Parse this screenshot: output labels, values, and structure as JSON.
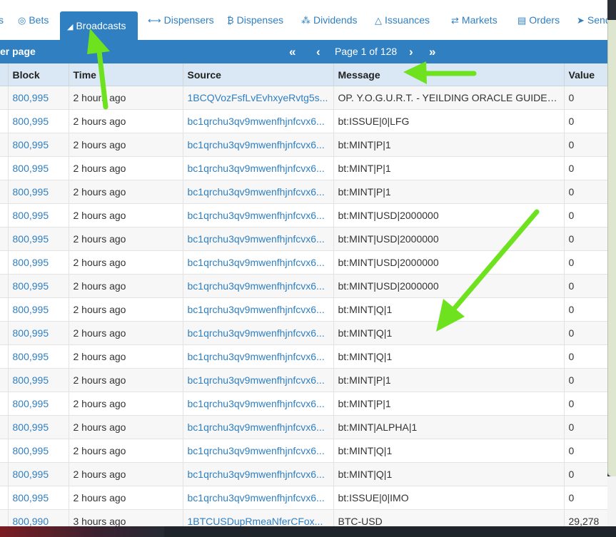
{
  "tabs": [
    {
      "label": "Bets",
      "icon": "target-icon",
      "glyph": "◎"
    },
    {
      "label": "Broadcasts",
      "icon": "megaphone-icon",
      "glyph": "📢",
      "active": true
    },
    {
      "label": "Dispensers",
      "icon": "arrows-horizontal-icon",
      "glyph": "⟷"
    },
    {
      "label": "Dispenses",
      "icon": "bitcoin-icon",
      "glyph": "₿"
    },
    {
      "label": "Dividends",
      "icon": "sitemap-icon",
      "glyph": "⁂"
    },
    {
      "label": "Issuances",
      "icon": "bank-icon",
      "glyph": "🏛"
    },
    {
      "label": "Markets",
      "icon": "exchange-icon",
      "glyph": "⇄"
    },
    {
      "label": "Orders",
      "icon": "book-icon",
      "glyph": "📘"
    },
    {
      "label": "Send",
      "icon": "paper-plane-icon",
      "glyph": "➤"
    }
  ],
  "pager": {
    "per_page_label": "er page",
    "first": "«",
    "prev": "‹",
    "page_text": "Page 1 of 128",
    "next": "›",
    "last": "»"
  },
  "table": {
    "headers": [
      "Block",
      "Time",
      "Source",
      "Message",
      "Value"
    ],
    "rows": [
      [
        "800,995",
        "2 hours ago",
        "1BCQVozFsfLvEvhxyeRvtg5s...",
        "OP. Y.O.G.U.R.T. - YEILDING ORACLE GUIDES...",
        "0"
      ],
      [
        "800,995",
        "2 hours ago",
        "bc1qrchu3qv9mwenfhjnfcvx6...",
        "bt:ISSUE|0|LFG",
        "0"
      ],
      [
        "800,995",
        "2 hours ago",
        "bc1qrchu3qv9mwenfhjnfcvx6...",
        "bt:MINT|P|1",
        "0"
      ],
      [
        "800,995",
        "2 hours ago",
        "bc1qrchu3qv9mwenfhjnfcvx6...",
        "bt:MINT|P|1",
        "0"
      ],
      [
        "800,995",
        "2 hours ago",
        "bc1qrchu3qv9mwenfhjnfcvx6...",
        "bt:MINT|P|1",
        "0"
      ],
      [
        "800,995",
        "2 hours ago",
        "bc1qrchu3qv9mwenfhjnfcvx6...",
        "bt:MINT|USD|2000000",
        "0"
      ],
      [
        "800,995",
        "2 hours ago",
        "bc1qrchu3qv9mwenfhjnfcvx6...",
        "bt:MINT|USD|2000000",
        "0"
      ],
      [
        "800,995",
        "2 hours ago",
        "bc1qrchu3qv9mwenfhjnfcvx6...",
        "bt:MINT|USD|2000000",
        "0"
      ],
      [
        "800,995",
        "2 hours ago",
        "bc1qrchu3qv9mwenfhjnfcvx6...",
        "bt:MINT|USD|2000000",
        "0"
      ],
      [
        "800,995",
        "2 hours ago",
        "bc1qrchu3qv9mwenfhjnfcvx6...",
        "bt:MINT|Q|1",
        "0"
      ],
      [
        "800,995",
        "2 hours ago",
        "bc1qrchu3qv9mwenfhjnfcvx6...",
        "bt:MINT|Q|1",
        "0"
      ],
      [
        "800,995",
        "2 hours ago",
        "bc1qrchu3qv9mwenfhjnfcvx6...",
        "bt:MINT|Q|1",
        "0"
      ],
      [
        "800,995",
        "2 hours ago",
        "bc1qrchu3qv9mwenfhjnfcvx6...",
        "bt:MINT|P|1",
        "0"
      ],
      [
        "800,995",
        "2 hours ago",
        "bc1qrchu3qv9mwenfhjnfcvx6...",
        "bt:MINT|P|1",
        "0"
      ],
      [
        "800,995",
        "2 hours ago",
        "bc1qrchu3qv9mwenfhjnfcvx6...",
        "bt:MINT|ALPHA|1",
        "0"
      ],
      [
        "800,995",
        "2 hours ago",
        "bc1qrchu3qv9mwenfhjnfcvx6...",
        "bt:MINT|Q|1",
        "0"
      ],
      [
        "800,995",
        "2 hours ago",
        "bc1qrchu3qv9mwenfhjnfcvx6...",
        "bt:MINT|Q|1",
        "0"
      ],
      [
        "800,995",
        "2 hours ago",
        "bc1qrchu3qv9mwenfhjnfcvx6...",
        "bt:ISSUE|0|IMO",
        "0"
      ],
      [
        "800,990",
        "3 hours ago",
        "1BTCUSDupRmeaNferCFox...",
        "BTC-USD",
        "29,278"
      ]
    ]
  },
  "colors": {
    "accent": "#2f7fc1",
    "header_bg": "#d9e8f4",
    "annotation_arrow": "#6ee21f"
  }
}
